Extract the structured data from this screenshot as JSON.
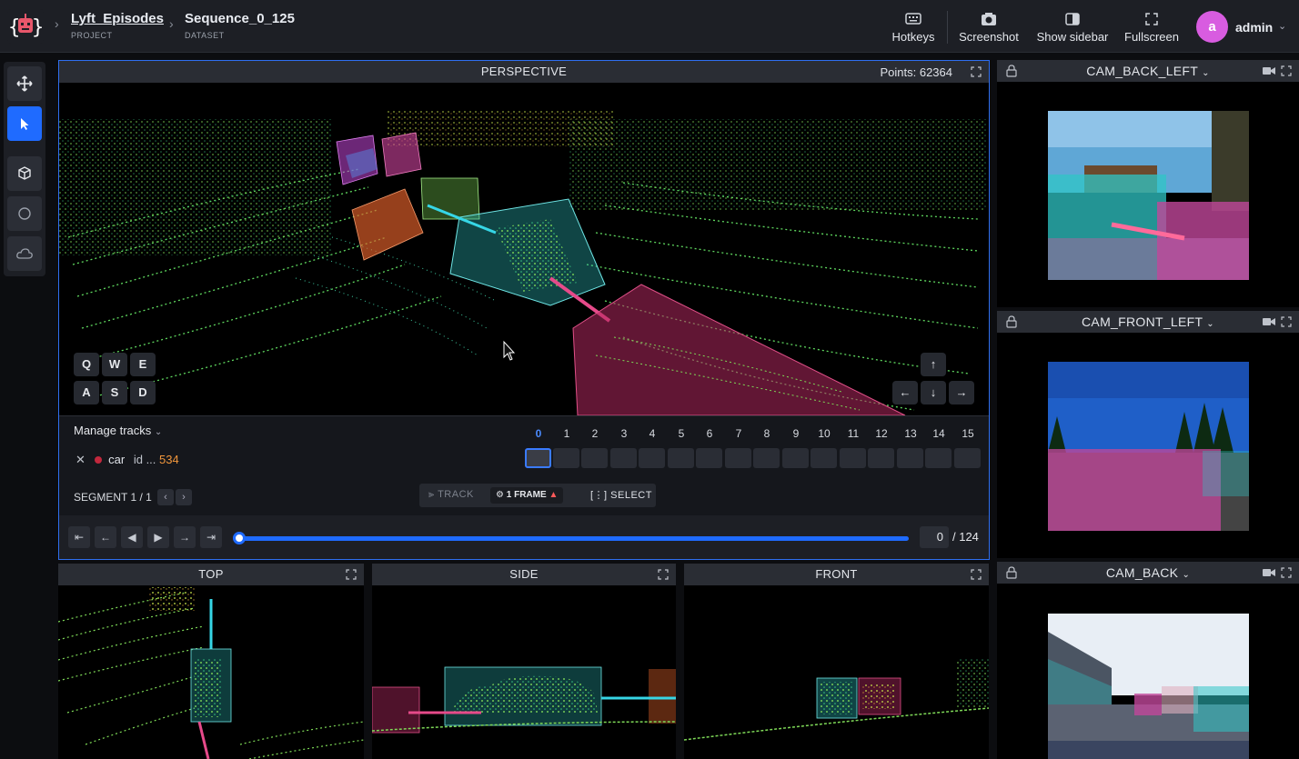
{
  "header": {
    "project": {
      "name": "Lyft_Episodes",
      "label": "PROJECT"
    },
    "dataset": {
      "name": "Sequence_0_125",
      "label": "DATASET"
    },
    "buttons": {
      "hotkeys": "Hotkeys",
      "screenshot": "Screenshot",
      "sidebar": "Show sidebar",
      "fullscreen": "Fullscreen"
    },
    "user": {
      "initial": "a",
      "name": "admin"
    },
    "colors": {
      "avatar": "#d85ce0",
      "accent": "#1f6bff"
    }
  },
  "toolbar": {
    "tools": [
      "move-icon",
      "pointer-icon",
      "cube-icon",
      "circle-icon",
      "cloud-icon"
    ],
    "active_tool": "pointer-icon"
  },
  "perspective": {
    "title": "PERSPECTIVE",
    "points_label": "Points: 62364",
    "keys_top": [
      "Q",
      "W",
      "E"
    ],
    "keys_bottom": [
      "A",
      "S",
      "D"
    ],
    "arrows": [
      "↑",
      "←",
      "↓",
      "→"
    ]
  },
  "tracks": {
    "manage_label": "Manage tracks",
    "frames": [
      "0",
      "1",
      "2",
      "3",
      "4",
      "5",
      "6",
      "7",
      "8",
      "9",
      "10",
      "11",
      "12",
      "13",
      "14",
      "15"
    ],
    "current_frame_index": 0,
    "track": {
      "class": "car",
      "id_label": "id ...",
      "id_value": "534",
      "color": "#c2283d"
    },
    "segment": "SEGMENT 1 / 1",
    "mode_track": "TRACK",
    "mode_frame": "1 FRAME",
    "mode_select": "SELECT"
  },
  "playback": {
    "current": "0",
    "total": "/ 124"
  },
  "views": {
    "top": "TOP",
    "side": "SIDE",
    "front": "FRONT"
  },
  "cameras": [
    {
      "title": "CAM_BACK_LEFT"
    },
    {
      "title": "CAM_FRONT_LEFT"
    },
    {
      "title": "CAM_BACK"
    }
  ]
}
